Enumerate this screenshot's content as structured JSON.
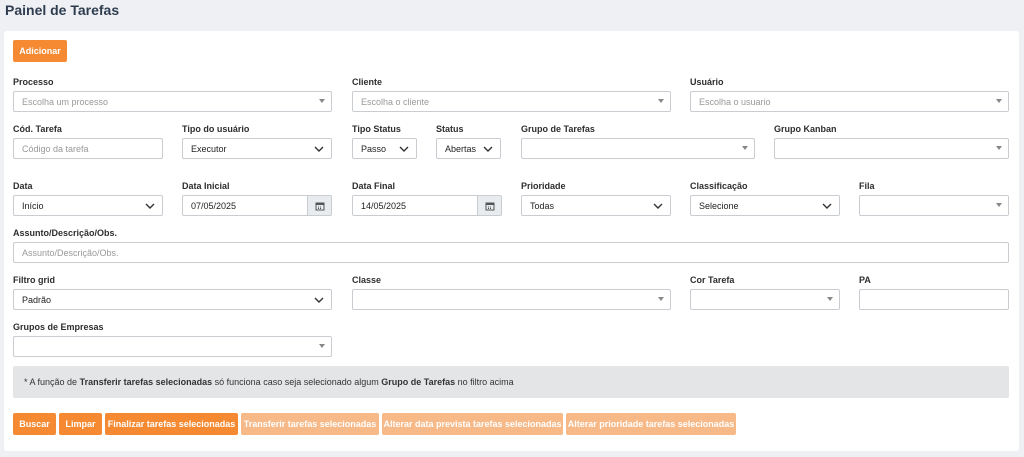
{
  "page": {
    "title": "Painel de Tarefas"
  },
  "buttons": {
    "add": "Adicionar",
    "search": "Buscar",
    "clear": "Limpar",
    "finish_selected": "Finalizar tarefas selecionadas",
    "transfer_selected": "Transferir tarefas selecionadas",
    "change_due_date": "Alterar data prevista tarefas selecionadas",
    "change_priority": "Alterar prioridade tarefas selecionadas"
  },
  "filters": {
    "processo": {
      "label": "Processo",
      "placeholder": "Escolha um processo"
    },
    "cliente": {
      "label": "Cliente",
      "placeholder": "Escolha o cliente"
    },
    "usuario": {
      "label": "Usuário",
      "placeholder": "Escolha o usuario"
    },
    "cod_tarefa": {
      "label": "Cód. Tarefa",
      "placeholder": "Código da tarefa"
    },
    "tipo_usuario": {
      "label": "Tipo do usuário",
      "value": "Executor"
    },
    "tipo_status": {
      "label": "Tipo Status",
      "value": "Passo"
    },
    "status": {
      "label": "Status",
      "value": "Abertas"
    },
    "grupo_tarefas": {
      "label": "Grupo de Tarefas",
      "value": ""
    },
    "grupo_kanban": {
      "label": "Grupo Kanban",
      "value": ""
    },
    "data": {
      "label": "Data",
      "value": "Início"
    },
    "data_inicial": {
      "label": "Data Inicial",
      "value": "07/05/2025"
    },
    "data_final": {
      "label": "Data Final",
      "value": "14/05/2025"
    },
    "prioridade": {
      "label": "Prioridade",
      "value": "Todas"
    },
    "classificacao": {
      "label": "Classificação",
      "value": "Selecione"
    },
    "fila": {
      "label": "Fila",
      "value": ""
    },
    "assunto": {
      "label": "Assunto/Descrição/Obs.",
      "placeholder": "Assunto/Descrição/Obs."
    },
    "filtro_grid": {
      "label": "Filtro grid",
      "value": "Padrão"
    },
    "classe": {
      "label": "Classe",
      "value": ""
    },
    "cor_tarefa": {
      "label": "Cor Tarefa",
      "value": ""
    },
    "pa": {
      "label": "PA",
      "value": ""
    },
    "grupos_empresas": {
      "label": "Grupos de Empresas",
      "value": ""
    }
  },
  "notice": {
    "prefix": "* A função de",
    "bold1": "Transferir tarefas selecionadas",
    "middle": "só funciona caso seja selecionado algum",
    "bold2": "Grupo de Tarefas",
    "suffix": "no filtro acima"
  },
  "colors": {
    "accent": "#f58a33",
    "accent_disabled": "#f7b988",
    "background": "#eef0f4"
  },
  "icons": {
    "calendar": "calendar-icon",
    "chevron": "chevron-down-icon",
    "caret": "caret-down-icon"
  }
}
